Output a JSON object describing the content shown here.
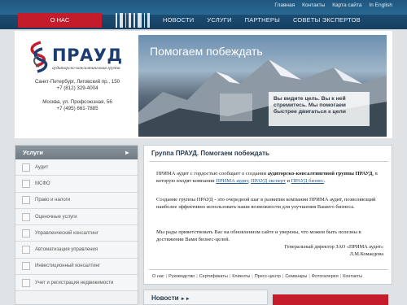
{
  "utility_links": [
    "Главная",
    "Контакты",
    "Карта сайта",
    "In English"
  ],
  "about_tab": "О НАС",
  "nav": [
    "НОВОСТИ",
    "УСЛУГИ",
    "ПАРТНЕРЫ",
    "СОВЕТЫ ЭКСПЕРТОВ"
  ],
  "logo": {
    "name": "ПРАУД",
    "subtitle": "аудиторско-консалтинговая группа"
  },
  "addresses": {
    "spb": [
      "Санкт-Петербург, Лиговский пр., 150",
      "+7 (812) 329-4004"
    ],
    "msk": [
      "Москва, ул. Профсоюзная, 56",
      "+7 (495) 661-7885"
    ]
  },
  "hero": {
    "title": "Помогаем побеждать",
    "caption": "Вы видите цель. Вы к ней стремитесь. Мы помогаем быстрее двигаться к цели"
  },
  "sidebar": {
    "title": "Услуги",
    "arrow": "►",
    "items": [
      "Аудит",
      "МСФО",
      "Право и налоги",
      "Оценочные услуги",
      "Управленческий консалтинг",
      "Автоматизация управления",
      "Инвестиционный консалтинг",
      "Учет и регистрация недвижимости"
    ]
  },
  "main": {
    "title": "Группа ПРАУД. Помогаем побеждать",
    "p1_start": "ПРИМА аудит с гордостью сообщает о создании ",
    "p1_bold": "аудиторско-консалтинговой группы ПРАУД",
    "p1_mid": ", в которую входят компании ",
    "link1": "ПРИМА аудит",
    "comma": ", ",
    "link2": "ПРАУД эксперт",
    "and": " и ",
    "link3": "ПРАУД бизнес",
    "dot": ".",
    "p2": "Создание группы ПРАУД - это очередной шаг в развитии компании ПРИМА аудит, позволяющий наиболее эффективно использовать наши возможности для улучшения Вашего бизнеса.",
    "p3": "Мы рады приветствовать Вас на обновленном сайте и уверены, что можем быть полезны в достижении Вами бизнес-целей.",
    "sign1": "Генеральный директор ЗАО «ПРИМА аудит»",
    "sign2": "Л.М.Комаедова"
  },
  "footer_links": [
    "О нас",
    "Руководство",
    "Сертификаты",
    "Клиенты",
    "Пресс-центр",
    "Семинары",
    "Фотогалерея",
    "Контакты"
  ],
  "news": {
    "title": "Новости",
    "arrow": "►►"
  },
  "colors": {
    "brand_red": "#c41c2b",
    "nav_blue": "#1b4c73",
    "logo_blue": "#1e3d73"
  }
}
